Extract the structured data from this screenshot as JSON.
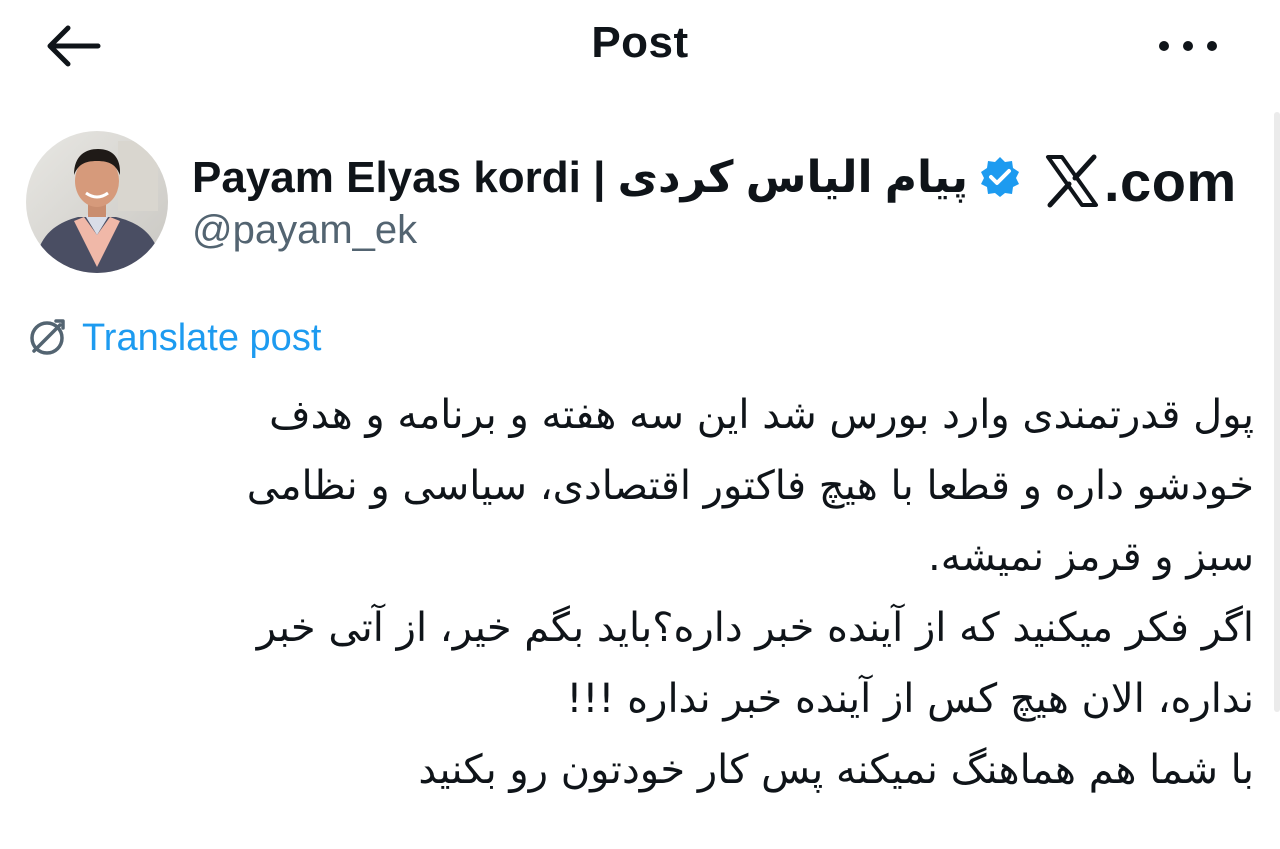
{
  "header": {
    "back_icon": "arrow-left-icon",
    "title": "Post",
    "more_icon": "more-horizontal-icon"
  },
  "author": {
    "name": "Payam Elyas kordi | پیام الیاس کردی",
    "handle": "@payam_ek",
    "verified_icon": "verified-badge-icon",
    "verified_color": "#1d9bf0"
  },
  "watermark": {
    "logo_icon": "x-logo-icon",
    "text": ".com"
  },
  "translate": {
    "icon": "globe-translate-icon",
    "label": "Translate post",
    "color": "#1d9bf0"
  },
  "post": {
    "lines": [
      "پول قدرتمندی وارد بورس شد این سه هفته و برنامه و هدف",
      "خودشو داره و قطعا با هیچ فاکتور اقتصادی، سیاسی و نظامی",
      "سبز و قرمز نمیشه.",
      "اگر فکر میکنید که از آینده خبر داره؟باید بگم خیر، از آتی خبر",
      "نداره، الان هیچ کس از آینده خبر نداره !!!",
      "با شما هم هماهنگ نمیکنه پس کار خودتون رو بکنید"
    ]
  }
}
